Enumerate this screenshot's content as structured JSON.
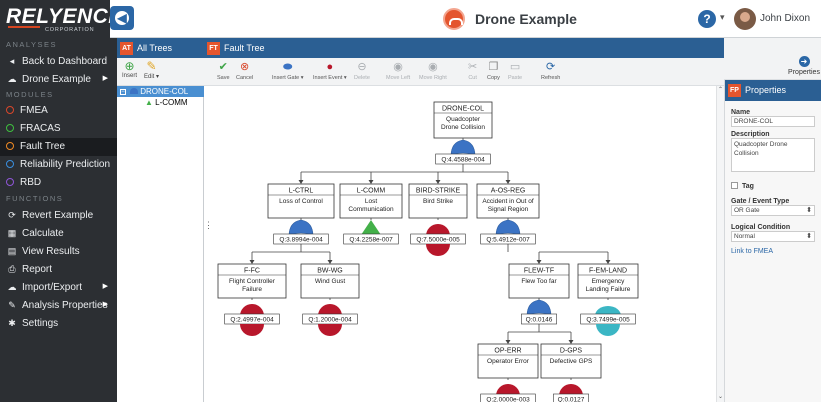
{
  "app": {
    "brand": "RELYENCE",
    "brand_sub": "CORPORATION",
    "project_title": "Drone Example",
    "user_name": "John Dixon",
    "nav_icon": "circle-arrow-left-icon",
    "help_icon": "question-circle-icon"
  },
  "sidebar": {
    "section_analyses": "ANALYSES",
    "back": "Back to Dashboard",
    "project": "Drone Example",
    "section_modules": "MODULES",
    "modules": [
      {
        "label": "FMEA",
        "color": "#d9472b"
      },
      {
        "label": "FRACAS",
        "color": "#3fbf3f"
      },
      {
        "label": "Fault Tree",
        "color": "#f08a24"
      },
      {
        "label": "Reliability Prediction",
        "color": "#3a8fe0"
      },
      {
        "label": "RBD",
        "color": "#8f56d8"
      }
    ],
    "section_functions": "FUNCTIONS",
    "functions": [
      {
        "label": "Revert Example",
        "icon": "refresh-icon"
      },
      {
        "label": "Calculate",
        "icon": "calculator-icon"
      },
      {
        "label": "View Results",
        "icon": "table-icon"
      },
      {
        "label": "Report",
        "icon": "print-icon"
      },
      {
        "label": "Import/Export",
        "icon": "cloud-upload-icon"
      },
      {
        "label": "Analysis Properties",
        "icon": "wrench-icon"
      },
      {
        "label": "Settings",
        "icon": "gear-icon"
      }
    ]
  },
  "trees_panel": {
    "badge": "AT",
    "title": "All Trees",
    "insert": "Insert",
    "edit": "Edit ▾",
    "nodes": [
      "DRONE-COL",
      "L-COMM"
    ]
  },
  "ft_panel": {
    "badge": "FT",
    "title": "Fault Tree",
    "toolbar": [
      {
        "label": "Save",
        "icon": "check-icon",
        "enabled": true
      },
      {
        "label": "Cancel",
        "icon": "x-circle-icon",
        "enabled": true
      },
      {
        "label": "Insert Gate ▾",
        "icon": "gate-icon",
        "enabled": true
      },
      {
        "label": "Insert Event ▾",
        "icon": "event-icon",
        "enabled": true
      },
      {
        "label": "Delete",
        "icon": "minus-icon",
        "enabled": false
      },
      {
        "label": "Move Left",
        "icon": "arrow-left-icon",
        "enabled": false
      },
      {
        "label": "Move Right",
        "icon": "arrow-right-icon",
        "enabled": false
      },
      {
        "label": "Cut",
        "icon": "scissors-icon",
        "enabled": false
      },
      {
        "label": "Copy",
        "icon": "copy-icon",
        "enabled": true
      },
      {
        "label": "Paste",
        "icon": "paste-icon",
        "enabled": false
      },
      {
        "label": "Refresh",
        "icon": "refresh-icon",
        "enabled": true
      }
    ],
    "properties_btn": "Properties"
  },
  "tree": {
    "nodes": [
      {
        "id": "DRONE-COL",
        "desc": [
          "Quadcopter",
          "Drone Collision"
        ],
        "q": "Q:4.4588e-004",
        "sym": "or"
      },
      {
        "id": "L-CTRL",
        "desc": [
          "Loss of Control"
        ],
        "q": "Q:3.8994e-004",
        "sym": "or"
      },
      {
        "id": "L-COMM",
        "desc": [
          "Lost",
          "Communication"
        ],
        "q": "Q:4.2258e-007",
        "sym": "transfer"
      },
      {
        "id": "BIRD-STRIKE",
        "desc": [
          "Bird Strike"
        ],
        "q": "Q:7.5000e-005",
        "sym": "basic"
      },
      {
        "id": "A-OS-REG",
        "desc": [
          "Accident in Out of",
          "Signal Region"
        ],
        "q": "Q:5.4912e-007",
        "sym": "or"
      },
      {
        "id": "F-FC",
        "desc": [
          "Flight Controller",
          "Failure"
        ],
        "q": "Q:2.4997e-004",
        "sym": "basic"
      },
      {
        "id": "BW-WG",
        "desc": [
          "Wind Gust"
        ],
        "q": "Q:1.2000e-004",
        "sym": "basic"
      },
      {
        "id": "FLEW-TF",
        "desc": [
          "Flew Too far"
        ],
        "q": "Q:0.0146",
        "sym": "or"
      },
      {
        "id": "F-EM-LAND",
        "desc": [
          "Emergency",
          "Landing Failure"
        ],
        "q": "Q:3.7499e-005",
        "sym": "cond"
      },
      {
        "id": "OP-ERR",
        "desc": [
          "Operator Error"
        ],
        "q": "Q:2.0000e-003",
        "sym": "basic"
      },
      {
        "id": "D-GPS",
        "desc": [
          "Defective GPS"
        ],
        "q": "Q:0.0127",
        "sym": "basic"
      }
    ]
  },
  "properties": {
    "badge": "FP",
    "title": "Properties",
    "name_label": "Name",
    "name_value": "DRONE-COL",
    "desc_label": "Description",
    "desc_value": "Quadcopter Drone Collision",
    "tag_label": "Tag",
    "gate_label": "Gate / Event Type",
    "gate_value": "OR Gate",
    "logic_label": "Logical Condition",
    "logic_value": "Normal",
    "link": "Link to FMEA"
  },
  "colors": {
    "accent": "#2b5f93",
    "or_gate": "#3b73c4",
    "basic_event": "#b8172b",
    "transfer": "#43b049",
    "condition": "#3bb6c4"
  }
}
